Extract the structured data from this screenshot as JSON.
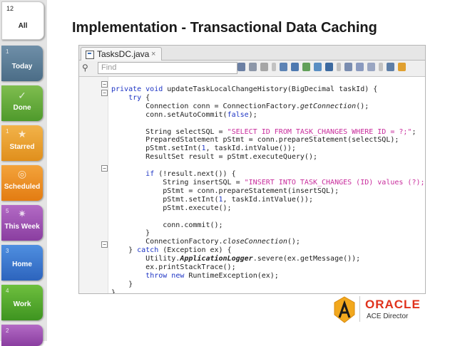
{
  "sidebar": {
    "items": [
      {
        "num": "12",
        "label": "All"
      },
      {
        "num": "1",
        "label": "Today"
      },
      {
        "num": "",
        "label": "Done"
      },
      {
        "num": "1",
        "label": "Starred"
      },
      {
        "num": "",
        "label": "Scheduled"
      },
      {
        "num": "5",
        "label": "This Week"
      },
      {
        "num": "3",
        "label": "Home"
      },
      {
        "num": "4",
        "label": "Work"
      },
      {
        "num": "2",
        "label": ""
      }
    ]
  },
  "slide": {
    "title": "Implementation - Transactional Data Caching"
  },
  "editor": {
    "file_tab": "TasksDC.java",
    "find_placeholder": "Find"
  },
  "logo": {
    "oracle": "ORACLE",
    "subtitle": "ACE Director",
    "accent_color": "#e0321c"
  }
}
